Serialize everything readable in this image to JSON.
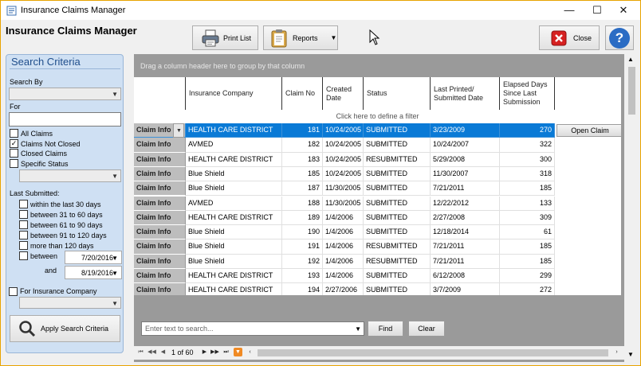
{
  "window": {
    "title": "Insurance Claims Manager",
    "minimize": "—",
    "maximize": "☐",
    "close": "✕"
  },
  "app_title": "Insurance Claims Manager",
  "toolbar": {
    "print_list": "Print List",
    "reports": "Reports",
    "close": "Close",
    "help": "?"
  },
  "search": {
    "title": "Search Criteria",
    "search_by_label": "Search By",
    "search_by_value": "",
    "for_label": "For",
    "for_value": "",
    "status_options": [
      {
        "label": "All Claims",
        "checked": false
      },
      {
        "label": "Claims Not Closed",
        "checked": true
      },
      {
        "label": "Closed Claims",
        "checked": false
      },
      {
        "label": "Specific Status",
        "checked": false
      }
    ],
    "specific_status_value": "",
    "last_submitted_label": "Last Submitted:",
    "ranges": [
      {
        "label": "within the last 30 days",
        "checked": false
      },
      {
        "label": "between 31 to 60 days",
        "checked": false
      },
      {
        "label": "between 61 to 90 days",
        "checked": false
      },
      {
        "label": "between 91 to 120 days",
        "checked": false
      },
      {
        "label": "more than 120 days",
        "checked": false
      }
    ],
    "between_label": "between",
    "and_label": "and",
    "date_from": "7/20/2016",
    "date_to": "8/19/2016",
    "insurance_company_label": "For Insurance Company",
    "insurance_company_value": "",
    "apply_label": "Apply Search Criteria"
  },
  "grid": {
    "group_hint": "Drag a column header here to group by that column",
    "filter_hint": "Click here to define a filter",
    "columns": {
      "company": "Insurance Company",
      "claim_no": "Claim No",
      "created": "Created Date",
      "status": "Status",
      "last_printed": "Last Printed/ Submitted Date",
      "elapsed": "Elapsed Days Since Last Submission"
    },
    "row_header_label": "Claim Info",
    "open_claim_label": "Open Claim",
    "rows": [
      {
        "company": "HEALTH CARE DISTRICT",
        "claim_no": "181",
        "created": "10/24/2005",
        "status": "SUBMITTED",
        "last": "3/23/2009",
        "elapsed": "270",
        "selected": true
      },
      {
        "company": "AVMED",
        "claim_no": "182",
        "created": "10/24/2005",
        "status": "SUBMITTED",
        "last": "10/24/2007",
        "elapsed": "322"
      },
      {
        "company": "HEALTH CARE DISTRICT",
        "claim_no": "183",
        "created": "10/24/2005",
        "status": "RESUBMITTED",
        "last": "5/29/2008",
        "elapsed": "300"
      },
      {
        "company": "Blue Shield",
        "claim_no": "185",
        "created": "10/24/2005",
        "status": "SUBMITTED",
        "last": "11/30/2007",
        "elapsed": "318"
      },
      {
        "company": "Blue Shield",
        "claim_no": "187",
        "created": "11/30/2005",
        "status": "SUBMITTED",
        "last": "7/21/2011",
        "elapsed": "185"
      },
      {
        "company": "AVMED",
        "claim_no": "188",
        "created": "11/30/2005",
        "status": "SUBMITTED",
        "last": "12/22/2012",
        "elapsed": "133"
      },
      {
        "company": "HEALTH CARE DISTRICT",
        "claim_no": "189",
        "created": "1/4/2006",
        "status": "SUBMITTED",
        "last": "2/27/2008",
        "elapsed": "309"
      },
      {
        "company": "Blue Shield",
        "claim_no": "190",
        "created": "1/4/2006",
        "status": "SUBMITTED",
        "last": "12/18/2014",
        "elapsed": "61"
      },
      {
        "company": "Blue Shield",
        "claim_no": "191",
        "created": "1/4/2006",
        "status": "RESUBMITTED",
        "last": "7/21/2011",
        "elapsed": "185"
      },
      {
        "company": "Blue Shield",
        "claim_no": "192",
        "created": "1/4/2006",
        "status": "RESUBMITTED",
        "last": "7/21/2011",
        "elapsed": "185"
      },
      {
        "company": "HEALTH CARE DISTRICT",
        "claim_no": "193",
        "created": "1/4/2006",
        "status": "SUBMITTED",
        "last": "6/12/2008",
        "elapsed": "299"
      },
      {
        "company": "HEALTH CARE DISTRICT",
        "claim_no": "194",
        "created": "2/27/2006",
        "status": "SUBMITTED",
        "last": "3/7/2009",
        "elapsed": "272"
      }
    ]
  },
  "searchbar": {
    "placeholder": "Enter text to search...",
    "find": "Find",
    "clear": "Clear"
  },
  "pager": {
    "text": "1 of 60"
  }
}
